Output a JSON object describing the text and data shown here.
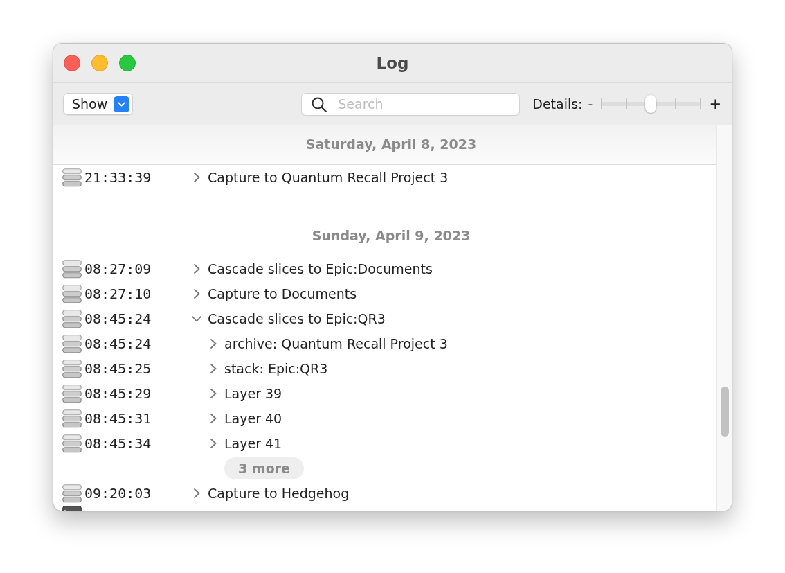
{
  "window": {
    "title": "Log"
  },
  "toolbar": {
    "show_button": {
      "label": "Show"
    },
    "search": {
      "placeholder": "Search"
    },
    "details": {
      "label": "Details:",
      "min_label": "-",
      "max_label": "+",
      "level": 0.5
    }
  },
  "log": {
    "sections": [
      {
        "date": "Saturday, April 8, 2023",
        "pinned": true,
        "entries": [
          {
            "kind": "stack",
            "time": "21:33:39",
            "text": "Capture to Quantum Recall Project 3",
            "expanded": false
          }
        ]
      },
      {
        "date": "Sunday, April 9, 2023",
        "pinned": false,
        "entries": [
          {
            "kind": "stack",
            "time": "08:27:09",
            "text": "Cascade slices to Epic:Documents",
            "expanded": false
          },
          {
            "kind": "stack",
            "time": "08:27:10",
            "text": "Capture to Documents",
            "expanded": false
          },
          {
            "kind": "stack",
            "time": "08:45:24",
            "text": "Cascade slices to Epic:QR3",
            "expanded": true,
            "children": [
              {
                "kind": "stack",
                "time": "08:45:24",
                "text": "archive: Quantum Recall Project 3",
                "expanded": false
              },
              {
                "kind": "stack",
                "time": "08:45:25",
                "text": "stack: Epic:QR3",
                "expanded": false
              },
              {
                "kind": "stack",
                "time": "08:45:29",
                "text": "Layer 39",
                "expanded": false
              },
              {
                "kind": "stack",
                "time": "08:45:31",
                "text": "Layer 40",
                "expanded": false
              },
              {
                "kind": "stack",
                "time": "08:45:34",
                "text": "Layer 41",
                "expanded": false
              }
            ],
            "more": "3 more"
          },
          {
            "kind": "stack",
            "time": "09:20:03",
            "text": "Capture to Hedgehog",
            "expanded": false
          },
          {
            "kind": "block"
          }
        ]
      }
    ]
  }
}
